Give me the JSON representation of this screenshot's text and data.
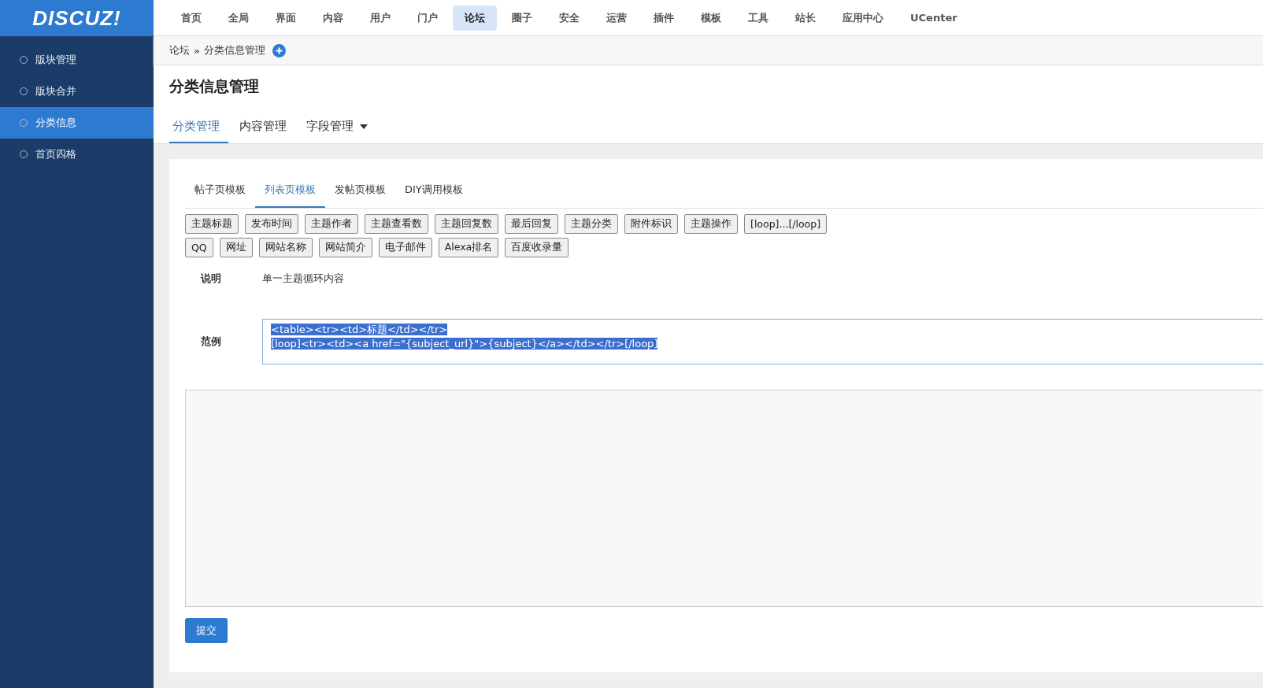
{
  "logo": "DISCUZ!",
  "top_nav": [
    {
      "label": "首页",
      "selected": false
    },
    {
      "label": "全局",
      "selected": false
    },
    {
      "label": "界面",
      "selected": false
    },
    {
      "label": "内容",
      "selected": false
    },
    {
      "label": "用户",
      "selected": false
    },
    {
      "label": "门户",
      "selected": false
    },
    {
      "label": "论坛",
      "selected": true
    },
    {
      "label": "圈子",
      "selected": false
    },
    {
      "label": "安全",
      "selected": false
    },
    {
      "label": "运营",
      "selected": false
    },
    {
      "label": "插件",
      "selected": false
    },
    {
      "label": "模板",
      "selected": false
    },
    {
      "label": "工具",
      "selected": false
    },
    {
      "label": "站长",
      "selected": false
    },
    {
      "label": "应用中心",
      "selected": false
    },
    {
      "label": "UCenter",
      "selected": false
    }
  ],
  "sidebar": {
    "items": [
      {
        "label": "版块管理",
        "selected": false
      },
      {
        "label": "版块合并",
        "selected": false
      },
      {
        "label": "分类信息",
        "selected": true
      },
      {
        "label": "首页四格",
        "selected": false
      }
    ]
  },
  "breadcrumb": {
    "parent": "论坛",
    "separator": "»",
    "current": "分类信息管理"
  },
  "page_title": "分类信息管理",
  "tabs": [
    {
      "label": "分类管理",
      "selected": true,
      "dropdown": false
    },
    {
      "label": "内容管理",
      "selected": false,
      "dropdown": false
    },
    {
      "label": "字段管理",
      "selected": false,
      "dropdown": true
    }
  ],
  "sub_tabs": [
    {
      "label": "帖子页模板",
      "selected": false
    },
    {
      "label": "列表页模板",
      "selected": true
    },
    {
      "label": "发帖页模板",
      "selected": false
    },
    {
      "label": "DIY调用模板",
      "selected": false
    }
  ],
  "tag_buttons": [
    [
      "主题标题",
      "发布时间",
      "主题作者",
      "主题查看数",
      "主题回复数",
      "最后回复",
      "主题分类",
      "附件标识",
      "主题操作",
      "[loop]...[/loop]"
    ],
    [
      "QQ",
      "网址",
      "网站名称",
      "网站简介",
      "电子邮件",
      "Alexa排名",
      "百度收录量"
    ]
  ],
  "description": {
    "label": "说明",
    "value": "单一主题循环内容"
  },
  "example": {
    "label": "范例",
    "selected": true,
    "lines": [
      "<table><tr><td>标题</td></tr>",
      "[loop]<tr><td><a href=\"{subject_url}\">{subject}</a></td></tr>[/loop]"
    ]
  },
  "submit": "提交"
}
